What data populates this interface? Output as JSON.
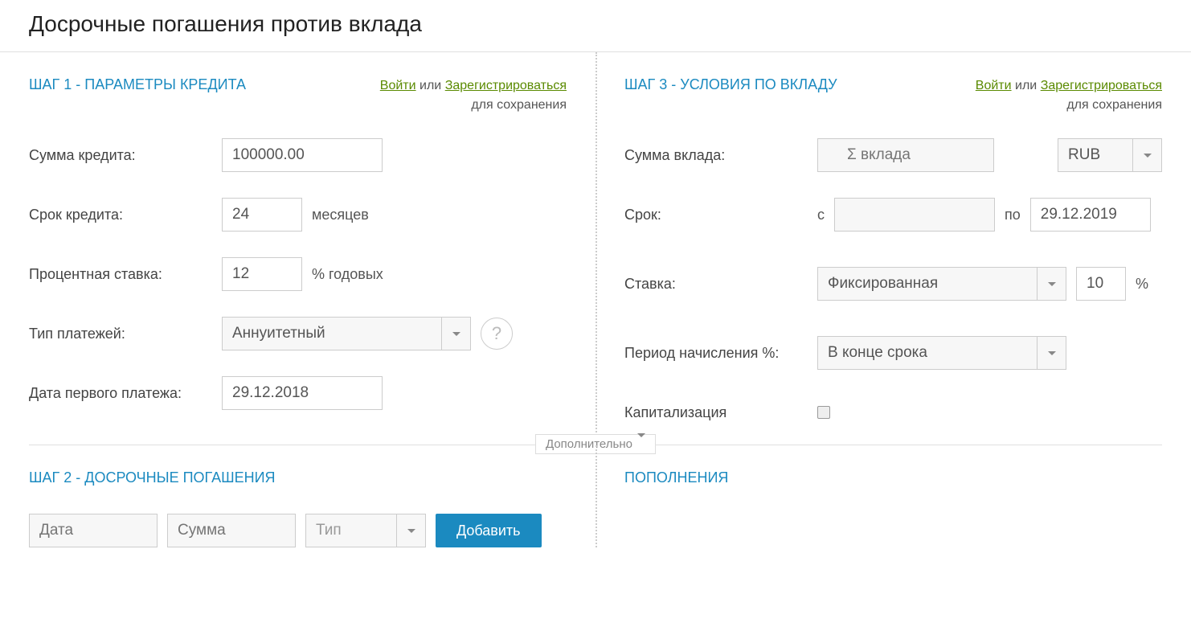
{
  "page": {
    "title": "Досрочные погашения против вклада"
  },
  "auth": {
    "login": "Войти",
    "or": "или",
    "register": "Зарегистрироваться",
    "note": "для сохранения"
  },
  "step1": {
    "title": "ШАГ 1 - ПАРАМЕТРЫ КРЕДИТА",
    "amount_label": "Сумма кредита:",
    "amount_value": "100000.00",
    "term_label": "Срок кредита:",
    "term_value": "24",
    "term_unit": "месяцев",
    "rate_label": "Процентная ставка:",
    "rate_value": "12",
    "rate_unit": "% годовых",
    "ptype_label": "Тип платежей:",
    "ptype_value": "Аннуитетный",
    "firstpay_label": "Дата первого платежа:",
    "firstpay_value": "29.12.2018"
  },
  "step3": {
    "title": "ШАГ 3 - УСЛОВИЯ ПО ВКЛАДУ",
    "amount_label": "Сумма вклада:",
    "amount_placeholder": "Σ вклада",
    "currency_value": "RUB",
    "term_label": "Срок:",
    "term_from": "с",
    "term_to": "по",
    "term_to_value": "29.12.2019",
    "rate_label": "Ставка:",
    "rate_type_value": "Фиксированная",
    "rate_value": "10",
    "rate_unit": "%",
    "period_label": "Период начисления %:",
    "period_value": "В конце срока",
    "cap_label": "Капитализация"
  },
  "midsep": {
    "label": "Дополнительно"
  },
  "step2": {
    "title": "ШАГ 2 - ДОСРОЧНЫЕ ПОГАШЕНИЯ",
    "date_placeholder": "Дата",
    "sum_placeholder": "Сумма",
    "type_placeholder": "Тип",
    "add_label": "Добавить"
  },
  "refill": {
    "title": "ПОПОЛНЕНИЯ"
  }
}
